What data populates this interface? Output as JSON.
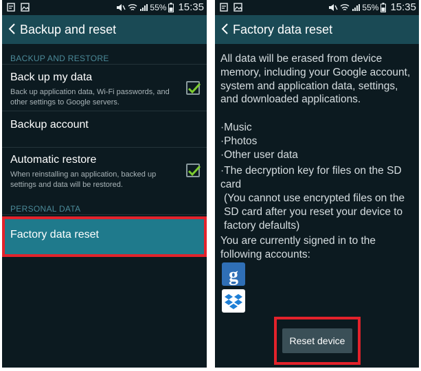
{
  "status_bar": {
    "battery": "55%",
    "time": "15:35"
  },
  "left_screen": {
    "title": "Backup and reset",
    "sections": {
      "backup_restore": "BACKUP AND RESTORE",
      "personal_data": "PERSONAL DATA"
    },
    "items": {
      "back_up_my_data": {
        "label": "Back up my data",
        "sub": "Back up application data, Wi-Fi passwords, and other settings to Google servers.",
        "checked": true
      },
      "backup_account": {
        "label": "Backup account"
      },
      "automatic_restore": {
        "label": "Automatic restore",
        "sub": "When reinstalling an application, backed up settings and data will be restored.",
        "checked": true
      },
      "factory_data_reset": {
        "label": "Factory data reset"
      }
    }
  },
  "right_screen": {
    "title": "Factory data reset",
    "intro": "All data will be erased from device memory, including your Google account, system and application data, settings, and downloaded applications.",
    "bullets": [
      "Music",
      "Photos",
      "Other user data",
      "The decryption key for files on the SD card"
    ],
    "note": "(You cannot use encrypted files on the SD card after you reset your device to factory defaults)",
    "accounts_text": "You are currently signed in to the following accounts:",
    "accounts": [
      {
        "icon": "google-icon",
        "glyph": "g",
        "color": "#2f6fb6"
      },
      {
        "icon": "dropbox-icon",
        "color": "#1e7fd6"
      }
    ],
    "reset_button": "Reset device"
  },
  "colors": {
    "highlight": "#e3222b",
    "accent": "#1f7a8c",
    "check": "#7ccb2f"
  }
}
